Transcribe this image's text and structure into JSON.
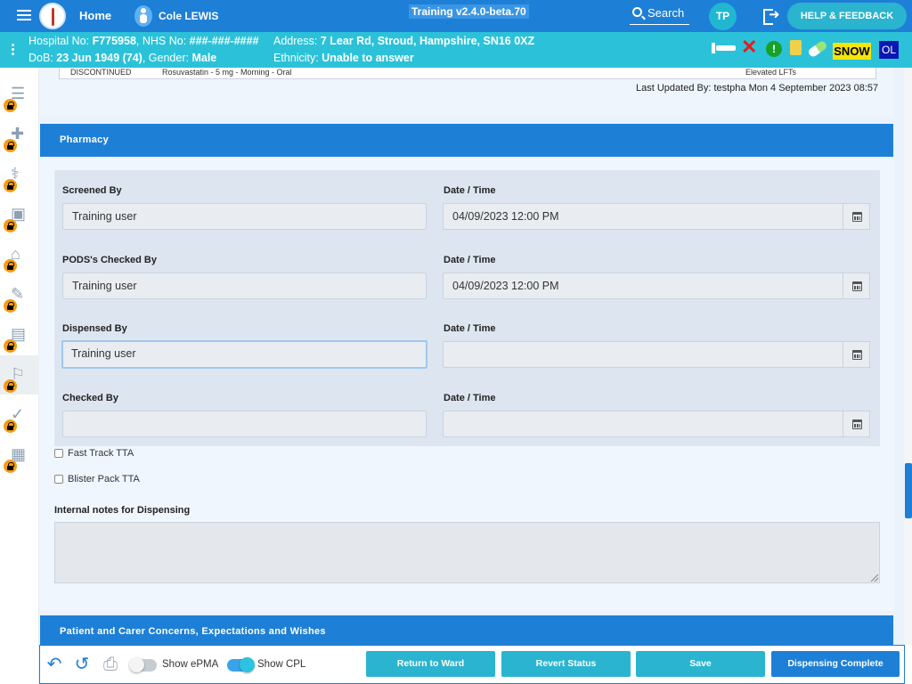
{
  "app": {
    "home_label": "Home",
    "patient_name": "Cole LEWIS",
    "version": "Training v2.4.0-beta.70",
    "search_label": "Search",
    "user_initials": "TP",
    "help_label": "HELP & FEEDBACK"
  },
  "banner": {
    "line1_prefix": "Hospital No: ",
    "hospital_no": "F775958",
    "nhs_prefix": ", NHS No: ",
    "nhs_no": "###-###-####",
    "address_prefix": "Address: ",
    "address": "7 Lear Rd, Stroud, Hampshire, SN16 0XZ",
    "dob_prefix": "DoB: ",
    "dob": "23 Jun 1949 (74)",
    "gender_prefix": ", Gender: ",
    "gender": "Male",
    "ethnicity_prefix": "Ethnicity: ",
    "ethnicity": "Unable to answer",
    "badges": [
      "SNOW",
      "OL"
    ]
  },
  "medication_row": {
    "status": "DISCONTINUED",
    "drug": "Rosuvastatin - 5 mg - Morning - Oral",
    "reason": "Elevated LFTs"
  },
  "last_updated": "Last Updated By: testpha Mon 4 September 2023 08:57",
  "pharmacy": {
    "title": "Pharmacy",
    "fields": [
      {
        "label": "Screened By",
        "value": "Training user",
        "date_label": "Date / Time",
        "date_value": "04/09/2023 12:00 PM"
      },
      {
        "label": "PODS's Checked By",
        "value": "Training user",
        "date_label": "Date / Time",
        "date_value": "04/09/2023 12:00 PM"
      },
      {
        "label": "Dispensed By",
        "value": "Training user",
        "date_label": "Date / Time",
        "date_value": ""
      },
      {
        "label": "Checked By",
        "value": "",
        "date_label": "Date / Time",
        "date_value": ""
      }
    ],
    "checkboxes": [
      "Fast Track TTA",
      "Blister Pack TTA"
    ],
    "notes_label": "Internal notes for Dispensing",
    "notes_value": ""
  },
  "next_section": "Patient and Carer Concerns, Expectations and Wishes",
  "toolbar": {
    "show_epma": "Show ePMA",
    "show_cpl": "Show CPL",
    "return_to_ward": "Return to Ward",
    "revert_status": "Revert Status",
    "save": "Save",
    "dispensing_complete": "Dispensing Complete"
  },
  "colors": {
    "primary": "#1e7fd6",
    "banner": "#2bc2d9",
    "accent": "#2ab4cf",
    "lock": "#f39c12"
  },
  "icons": [
    "menu-icon",
    "logo-icon",
    "person-icon",
    "search-icon",
    "logout-icon",
    "bed-icon",
    "x-icon",
    "alert-icon",
    "document-icon",
    "pill-icon",
    "lock-icon",
    "calendar-icon",
    "undo-icon",
    "history-icon",
    "print-icon"
  ]
}
